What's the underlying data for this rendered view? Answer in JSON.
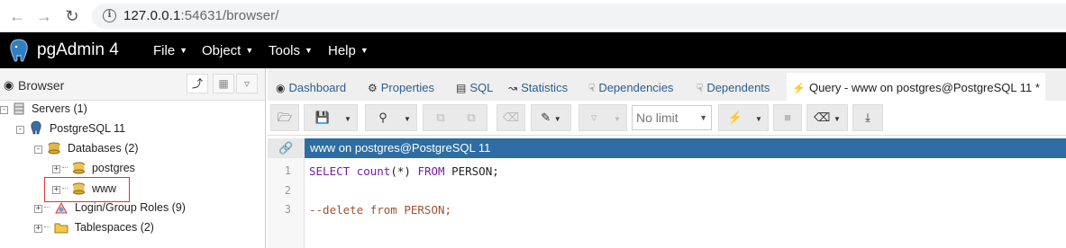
{
  "browser": {
    "url_host": "127.0.0.1",
    "url_rest": ":54631/browser/"
  },
  "app": {
    "brand": "pgAdmin 4",
    "menus": [
      "File",
      "Object",
      "Tools",
      "Help"
    ]
  },
  "left_panel": {
    "title": "Browser",
    "tree": [
      {
        "label": "Servers (1)",
        "icon": "servers-icon"
      },
      {
        "label": "PostgreSQL 11",
        "icon": "elephant-icon"
      },
      {
        "label": "Databases (2)",
        "icon": "databases-icon"
      },
      {
        "label": "postgres",
        "icon": "database-icon"
      },
      {
        "label": "www",
        "icon": "database-icon"
      },
      {
        "label": "Login/Group Roles (9)",
        "icon": "roles-icon"
      },
      {
        "label": "Tablespaces (2)",
        "icon": "folder-icon"
      }
    ]
  },
  "tabs": [
    {
      "label": "Dashboard",
      "icon": "dashboard-icon"
    },
    {
      "label": "Properties",
      "icon": "gears-icon"
    },
    {
      "label": "SQL",
      "icon": "file-icon"
    },
    {
      "label": "Statistics",
      "icon": "line-chart-icon"
    },
    {
      "label": "Dependencies",
      "icon": "hand-icon"
    },
    {
      "label": "Dependents",
      "icon": "hand-icon"
    },
    {
      "label": "Query - www on postgres@PostgreSQL 11 *",
      "icon": "bolt-icon"
    }
  ],
  "toolbar": {
    "limit_value": "No limit"
  },
  "query": {
    "connection": "www on postgres@PostgreSQL 11",
    "lines": [
      {
        "num": "1",
        "text": ""
      },
      {
        "num": "2",
        "text": ""
      },
      {
        "num": "3",
        "text": "--delete from PERSON;"
      }
    ],
    "line1": {
      "select": "SELECT",
      "func": "count",
      "args": "(*) ",
      "from": "FROM",
      "rest": " PERSON;"
    }
  }
}
